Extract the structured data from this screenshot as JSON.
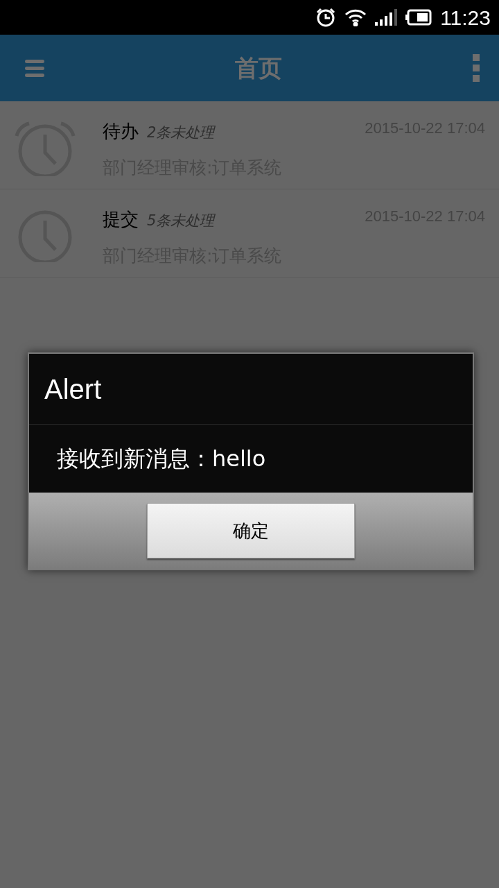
{
  "status_bar": {
    "time": "11:23"
  },
  "app_bar": {
    "title": "首页"
  },
  "items": [
    {
      "kind": "alarm",
      "title": "待办",
      "count": "2条未处理",
      "subtitle": "部门经理审核:订单系统",
      "time": "2015-10-22 17:04"
    },
    {
      "kind": "clock",
      "title": "提交",
      "count": "5条未处理",
      "subtitle": "部门经理审核:订单系统",
      "time": "2015-10-22 17:04"
    }
  ],
  "dialog": {
    "title": "Alert",
    "message": "接收到新消息：hello",
    "buttons": [
      "确定"
    ]
  }
}
